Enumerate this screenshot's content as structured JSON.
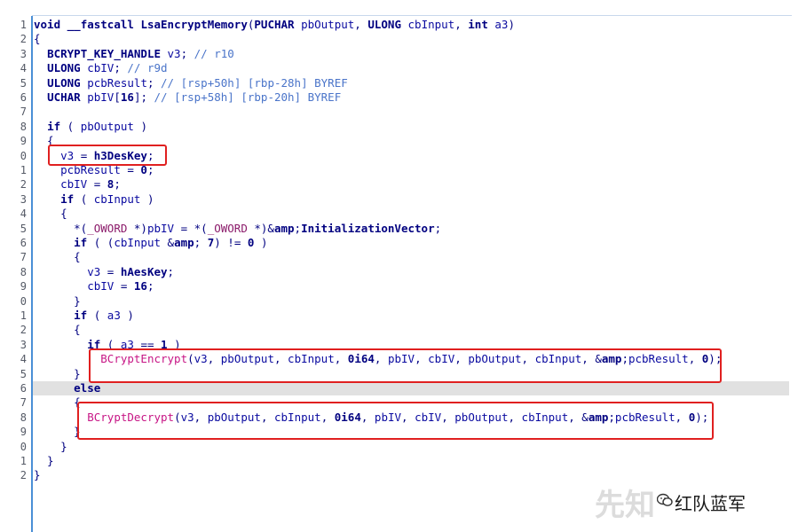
{
  "code_lines": [
    {
      "no": "1",
      "text": "void __fastcall LsaEncryptMemory(PUCHAR pbOutput, ULONG cbInput, int a3)"
    },
    {
      "no": "2",
      "text": "{"
    },
    {
      "no": "3",
      "text": "  BCRYPT_KEY_HANDLE v3; // r10"
    },
    {
      "no": "4",
      "text": "  ULONG cbIV; // r9d"
    },
    {
      "no": "5",
      "text": "  ULONG pcbResult; // [rsp+50h] [rbp-28h] BYREF"
    },
    {
      "no": "6",
      "text": "  UCHAR pbIV[16]; // [rsp+58h] [rbp-20h] BYREF"
    },
    {
      "no": "7",
      "text": ""
    },
    {
      "no": "8",
      "text": "  if ( pbOutput )"
    },
    {
      "no": "9",
      "text": "  {"
    },
    {
      "no": "0",
      "text": "    v3 = h3DesKey;"
    },
    {
      "no": "1",
      "text": "    pcbResult = 0;"
    },
    {
      "no": "2",
      "text": "    cbIV = 8;"
    },
    {
      "no": "3",
      "text": "    if ( cbInput )"
    },
    {
      "no": "4",
      "text": "    {"
    },
    {
      "no": "5",
      "text": "      *(_OWORD *)pbIV = *(_OWORD *)&InitializationVector;"
    },
    {
      "no": "6",
      "text": "      if ( (cbInput & 7) != 0 )"
    },
    {
      "no": "7",
      "text": "      {"
    },
    {
      "no": "8",
      "text": "        v3 = hAesKey;"
    },
    {
      "no": "9",
      "text": "        cbIV = 16;"
    },
    {
      "no": "0",
      "text": "      }"
    },
    {
      "no": "1",
      "text": "      if ( a3 )"
    },
    {
      "no": "2",
      "text": "      {"
    },
    {
      "no": "3",
      "text": "        if ( a3 == 1 )"
    },
    {
      "no": "4",
      "text": "          BCryptEncrypt(v3, pbOutput, cbInput, 0i64, pbIV, cbIV, pbOutput, cbInput, &pcbResult, 0);"
    },
    {
      "no": "5",
      "text": "      }"
    },
    {
      "no": "6",
      "text": "      else"
    },
    {
      "no": "7",
      "text": "      {"
    },
    {
      "no": "8",
      "text": "        BCryptDecrypt(v3, pbOutput, cbInput, 0i64, pbIV, cbIV, pbOutput, cbInput, &pcbResult, 0);"
    },
    {
      "no": "9",
      "text": "      }"
    },
    {
      "no": "0",
      "text": "    }"
    },
    {
      "no": "1",
      "text": "  }"
    },
    {
      "no": "2",
      "text": "}"
    }
  ],
  "highlight_line": 26,
  "watermark": {
    "text": "红队蓝军",
    "logo_text": "先知"
  },
  "colors": {
    "gutter_border": "#4a8fd6",
    "highlight": "#e1e1e1",
    "annotation_box": "#e02020"
  }
}
